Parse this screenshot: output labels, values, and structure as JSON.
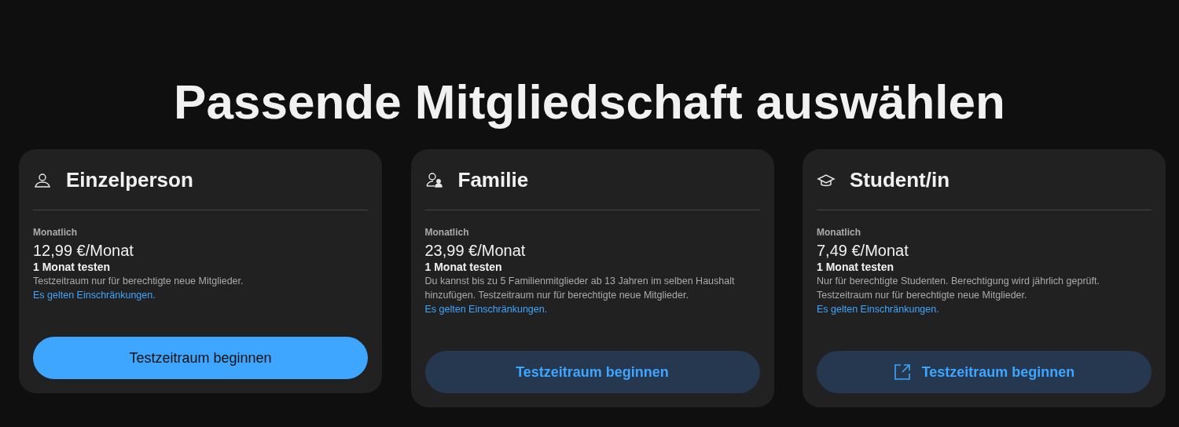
{
  "heading": "Passende Mitgliedschaft auswählen",
  "plans": [
    {
      "kind": "person",
      "title": "Einzelperson",
      "period": "Monatlich",
      "price": "12,99 €/Monat",
      "trial": "1 Monat testen",
      "description": "Testzeitraum nur für berechtigte neue Mitglieder.",
      "link": "Es gelten Einschränkungen.",
      "button": {
        "label": "Testzeitraum beginnen",
        "kind": "primary",
        "external": false
      }
    },
    {
      "kind": "family",
      "title": "Familie",
      "period": "Monatlich",
      "price": "23,99 €/Monat",
      "trial": "1 Monat testen",
      "description": "Du kannst bis zu 5 Familienmitglieder ab 13 Jahren im selben Haushalt hinzufügen. Testzeitraum nur für berechtigte neue Mitglieder.",
      "link": "Es gelten Einschränkungen.",
      "button": {
        "label": "Testzeitraum beginnen",
        "kind": "tonal",
        "external": false
      }
    },
    {
      "kind": "student",
      "title": "Student/in",
      "period": "Monatlich",
      "price": "7,49 €/Monat",
      "trial": "1 Monat testen",
      "description": "Nur für berechtigte Studenten. Berechtigung wird jährlich geprüft. Testzeitraum nur für berechtigte neue Mitglieder.",
      "link": "Es gelten Einschränkungen.",
      "button": {
        "label": "Testzeitraum beginnen",
        "kind": "tonal",
        "external": true
      }
    }
  ]
}
